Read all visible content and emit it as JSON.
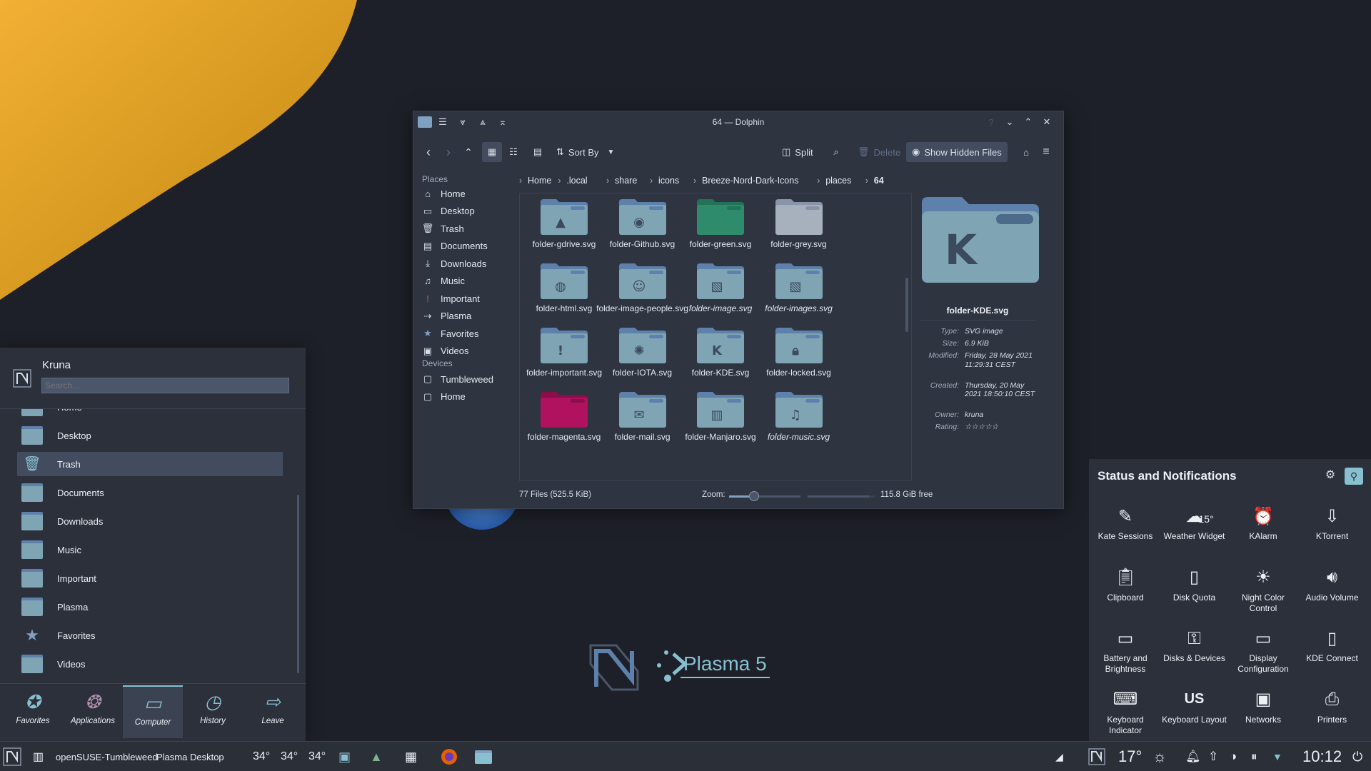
{
  "colors": {
    "accent": "#88c0d0",
    "folder": "#7fa4b3",
    "folder_tab": "#5e81ac",
    "panel": "#2b303b",
    "window": "#2e3440",
    "magenta": "#b0125f",
    "green": "#2e8b6b"
  },
  "dolphin": {
    "title": "64 — Dolphin",
    "toolbar": {
      "sort_by": "Sort By",
      "split": "Split",
      "delete": "Delete",
      "show_hidden": "Show Hidden Files"
    },
    "breadcrumb": [
      "Home",
      ".local",
      "share",
      "icons",
      "Breeze-Nord-Dark-Icons",
      "places",
      "64"
    ],
    "places_header": "Places",
    "places": [
      {
        "label": "Home",
        "icon": "home-icon"
      },
      {
        "label": "Desktop",
        "icon": "desktop-icon"
      },
      {
        "label": "Trash",
        "icon": "trash-icon"
      },
      {
        "label": "Documents",
        "icon": "documents-icon"
      },
      {
        "label": "Downloads",
        "icon": "downloads-icon"
      },
      {
        "label": "Music",
        "icon": "music-icon"
      },
      {
        "label": "Important",
        "icon": "important-icon"
      },
      {
        "label": "Plasma",
        "icon": "plasma-icon"
      },
      {
        "label": "Favorites",
        "icon": "star-icon"
      },
      {
        "label": "Videos",
        "icon": "videos-icon"
      }
    ],
    "devices_header": "Devices",
    "devices": [
      {
        "label": "Tumbleweed",
        "icon": "drive-icon"
      },
      {
        "label": "Home",
        "icon": "drive-icon"
      }
    ],
    "files": [
      {
        "name": "folder-gdrive.svg",
        "emblem": "gdrive"
      },
      {
        "name": "folder-Github.svg",
        "emblem": "github"
      },
      {
        "name": "folder-green.svg",
        "emblem": "green"
      },
      {
        "name": "folder-grey.svg",
        "emblem": "grey"
      },
      {
        "name": "folder-html.svg",
        "emblem": "html"
      },
      {
        "name": "folder-image-people.svg",
        "emblem": "people"
      },
      {
        "name": "folder-image.svg",
        "emblem": "image",
        "italic": true
      },
      {
        "name": "folder-images.svg",
        "emblem": "image",
        "italic": true
      },
      {
        "name": "folder-important.svg",
        "emblem": "important"
      },
      {
        "name": "folder-IOTA.svg",
        "emblem": "iota"
      },
      {
        "name": "folder-KDE.svg",
        "emblem": "kde"
      },
      {
        "name": "folder-locked.svg",
        "emblem": "lock"
      },
      {
        "name": "folder-magenta.svg",
        "emblem": "magenta"
      },
      {
        "name": "folder-mail.svg",
        "emblem": "mail"
      },
      {
        "name": "folder-Manjaro.svg",
        "emblem": "manjaro"
      },
      {
        "name": "folder-music.svg",
        "emblem": "music",
        "italic": true
      }
    ],
    "preview": {
      "name": "folder-KDE.svg",
      "info": [
        {
          "k": "Type:",
          "v": "SVG image"
        },
        {
          "k": "Size:",
          "v": "6.9 KiB"
        },
        {
          "k": "Modified:",
          "v": "Friday, 28 May 2021 11:29:31 CEST"
        },
        {
          "k": "Created:",
          "v": "Thursday, 20 May 2021 18:50:10 CEST"
        },
        {
          "k": "Owner:",
          "v": "kruna"
        },
        {
          "k": "Rating:",
          "v": "☆☆☆☆☆"
        }
      ]
    },
    "status": {
      "count": "77 Files (525.5 KiB)",
      "zoom_label": "Zoom:",
      "free": "115.8 GiB free",
      "zoom_level": 0.35,
      "free_fraction": 0.92
    }
  },
  "launcher": {
    "user": "Kruna",
    "search_placeholder": "Search...",
    "items": [
      "Home",
      "Desktop",
      "Trash",
      "Documents",
      "Downloads",
      "Music",
      "Important",
      "Plasma",
      "Favorites",
      "Videos"
    ],
    "tabs": [
      {
        "label": "Favorites",
        "icon": "favorites-icon"
      },
      {
        "label": "Applications",
        "icon": "applications-icon"
      },
      {
        "label": "Computer",
        "icon": "computer-icon"
      },
      {
        "label": "History",
        "icon": "history-icon"
      },
      {
        "label": "Leave",
        "icon": "leave-icon"
      }
    ]
  },
  "logo": {
    "text": "Plasma 5"
  },
  "status_panel": {
    "title": "Status and Notifications",
    "weather_temp": "15°",
    "items": [
      {
        "label": "Kate Sessions",
        "icon": "kate-icon"
      },
      {
        "label": "Weather Widget",
        "icon": "weather-icon"
      },
      {
        "label": "KAlarm",
        "icon": "alarm-icon"
      },
      {
        "label": "KTorrent",
        "icon": "torrent-icon"
      },
      {
        "label": "Clipboard",
        "icon": "clipboard-icon"
      },
      {
        "label": "Disk Quota",
        "icon": "disk-quota-icon"
      },
      {
        "label": "Night Color Control",
        "icon": "night-color-icon"
      },
      {
        "label": "Audio Volume",
        "icon": "volume-icon"
      },
      {
        "label": "Battery and Brightness",
        "icon": "battery-icon"
      },
      {
        "label": "Disks & Devices",
        "icon": "usb-icon"
      },
      {
        "label": "Display Configuration",
        "icon": "display-icon"
      },
      {
        "label": "KDE Connect",
        "icon": "phone-icon"
      },
      {
        "label": "Keyboard Indicator",
        "icon": "keyboard-icon"
      },
      {
        "label": "Keyboard Layout",
        "icon": "keyboard-layout-icon",
        "glyph": "US"
      },
      {
        "label": "Networks",
        "icon": "network-icon"
      },
      {
        "label": "Printers",
        "icon": "printer-icon"
      }
    ]
  },
  "taskbar": {
    "task1": "openSUSE-Tumbleweed",
    "task2": "Plasma Desktop",
    "temps": [
      "34°",
      "34°",
      "34°"
    ],
    "weather": "17°",
    "clock": "10:12"
  }
}
